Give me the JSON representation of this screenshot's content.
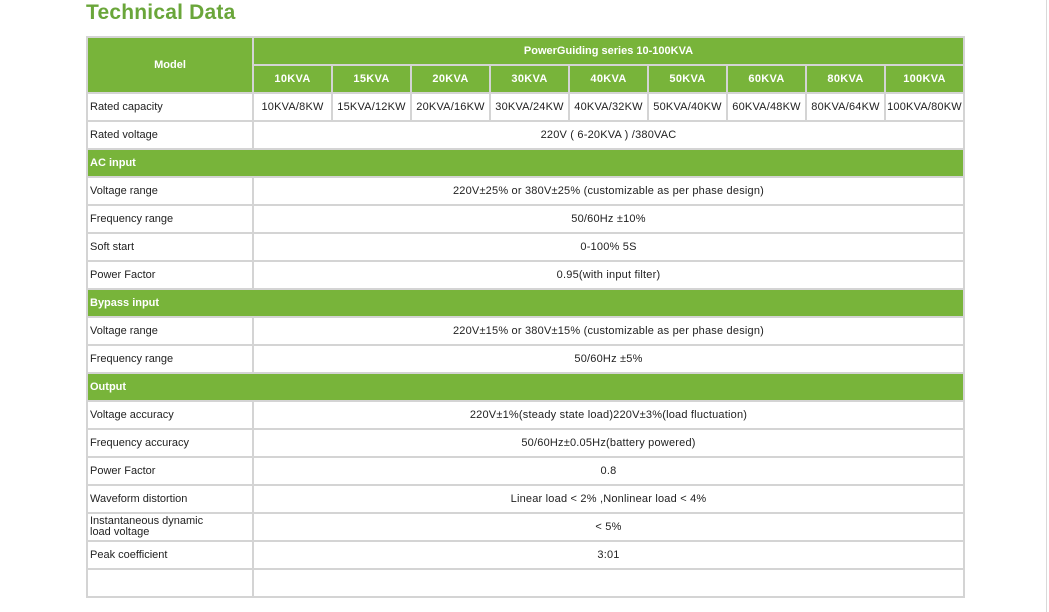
{
  "page": {
    "title": "Technical Data"
  },
  "table": {
    "model_label": "Model",
    "series_label": "PowerGuiding series 10-100KVA",
    "models": [
      "10KVA",
      "15KVA",
      "20KVA",
      "30KVA",
      "40KVA",
      "50KVA",
      "60KVA",
      "80KVA",
      "100KVA"
    ],
    "rated_capacity": {
      "label": "Rated capacity",
      "values": [
        "10KVA/8KW",
        "15KVA/12KW",
        "20KVA/16KW",
        "30KVA/24KW",
        "40KVA/32KW",
        "50KVA/40KW",
        "60KVA/48KW",
        "80KVA/64KW",
        "100KVA/80KW"
      ]
    },
    "rated_voltage": {
      "label": "Rated voltage",
      "value": "220V ( 6-20KVA ) /380VAC"
    },
    "sections": [
      {
        "title": "AC input",
        "rows": [
          {
            "label": "Voltage range",
            "value": "220V±25% or 380V±25% (customizable as per phase design)"
          },
          {
            "label": "Frequency range",
            "value": "50/60Hz ±10%"
          },
          {
            "label": "Soft start",
            "value": "0-100% 5S"
          },
          {
            "label": "Power Factor",
            "value": "0.95(with input filter)"
          }
        ]
      },
      {
        "title": "Bypass input",
        "rows": [
          {
            "label": "Voltage range",
            "value": "220V±15% or 380V±15% (customizable as per phase design)"
          },
          {
            "label": "Frequency range",
            "value": "50/60Hz ±5%"
          }
        ]
      },
      {
        "title": "Output",
        "rows": [
          {
            "label": "Voltage accuracy",
            "value": "220V±1%(steady state load)220V±3%(load fluctuation)"
          },
          {
            "label": "Frequency accuracy",
            "value": "50/60Hz±0.05Hz(battery powered)"
          },
          {
            "label": "Power Factor",
            "value": "0.8"
          },
          {
            "label": "Waveform distortion",
            "value": "Linear load < 2% ,Nonlinear load < 4%"
          },
          {
            "label": "Instantaneous dynamic load voltage",
            "value": "< 5%"
          },
          {
            "label": "Peak coefficient",
            "value": "3:01"
          }
        ]
      }
    ]
  }
}
